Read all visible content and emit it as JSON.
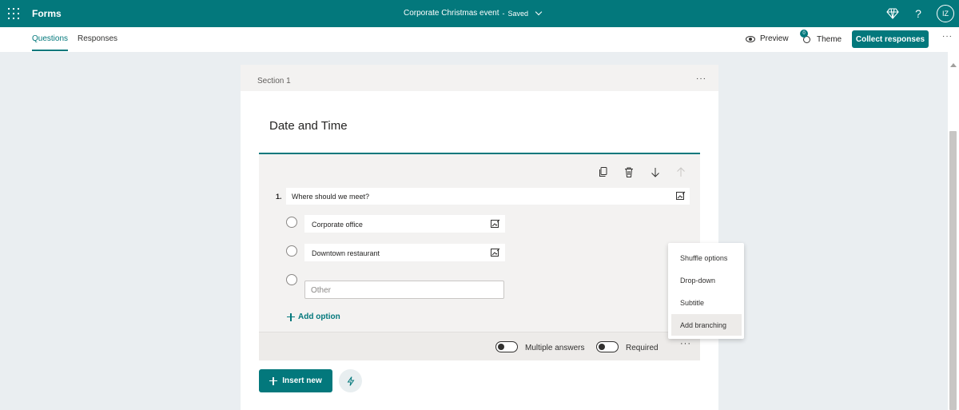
{
  "topbar": {
    "app_name": "Forms",
    "doc_title": "Corporate Christmas event",
    "separator": "-",
    "status": "Saved",
    "avatar_initials": "IZ",
    "help_glyph": "?",
    "icons": [
      "app-launcher-icon",
      "diamond-icon",
      "help-icon"
    ]
  },
  "subnav": {
    "tabs": [
      {
        "label": "Questions"
      },
      {
        "label": "Responses"
      }
    ],
    "preview_label": "Preview",
    "theme_label": "Theme",
    "theme_badge": "0",
    "collect_label": "Collect responses",
    "more": "···"
  },
  "form": {
    "section_label": "Section 1",
    "section_more": "···",
    "title": "Date and Time",
    "question": {
      "number": "1.",
      "text": "Where should we meet?",
      "options": [
        {
          "label": "Corporate office"
        },
        {
          "label": "Downtown restaurant"
        }
      ],
      "other_placeholder": "Other",
      "add_option_label": "Add option",
      "multiple_answers_label": "Multiple answers",
      "required_label": "Required",
      "footer_more": "···"
    },
    "insert_new_label": "Insert new"
  },
  "context_menu": {
    "items": [
      {
        "label": "Shuffle options"
      },
      {
        "label": "Drop-down"
      },
      {
        "label": "Subtitle"
      },
      {
        "label": "Add branching"
      }
    ],
    "hovered": "Add branching"
  },
  "colors": {
    "accent": "#03787c",
    "background": "#eaeef1"
  }
}
